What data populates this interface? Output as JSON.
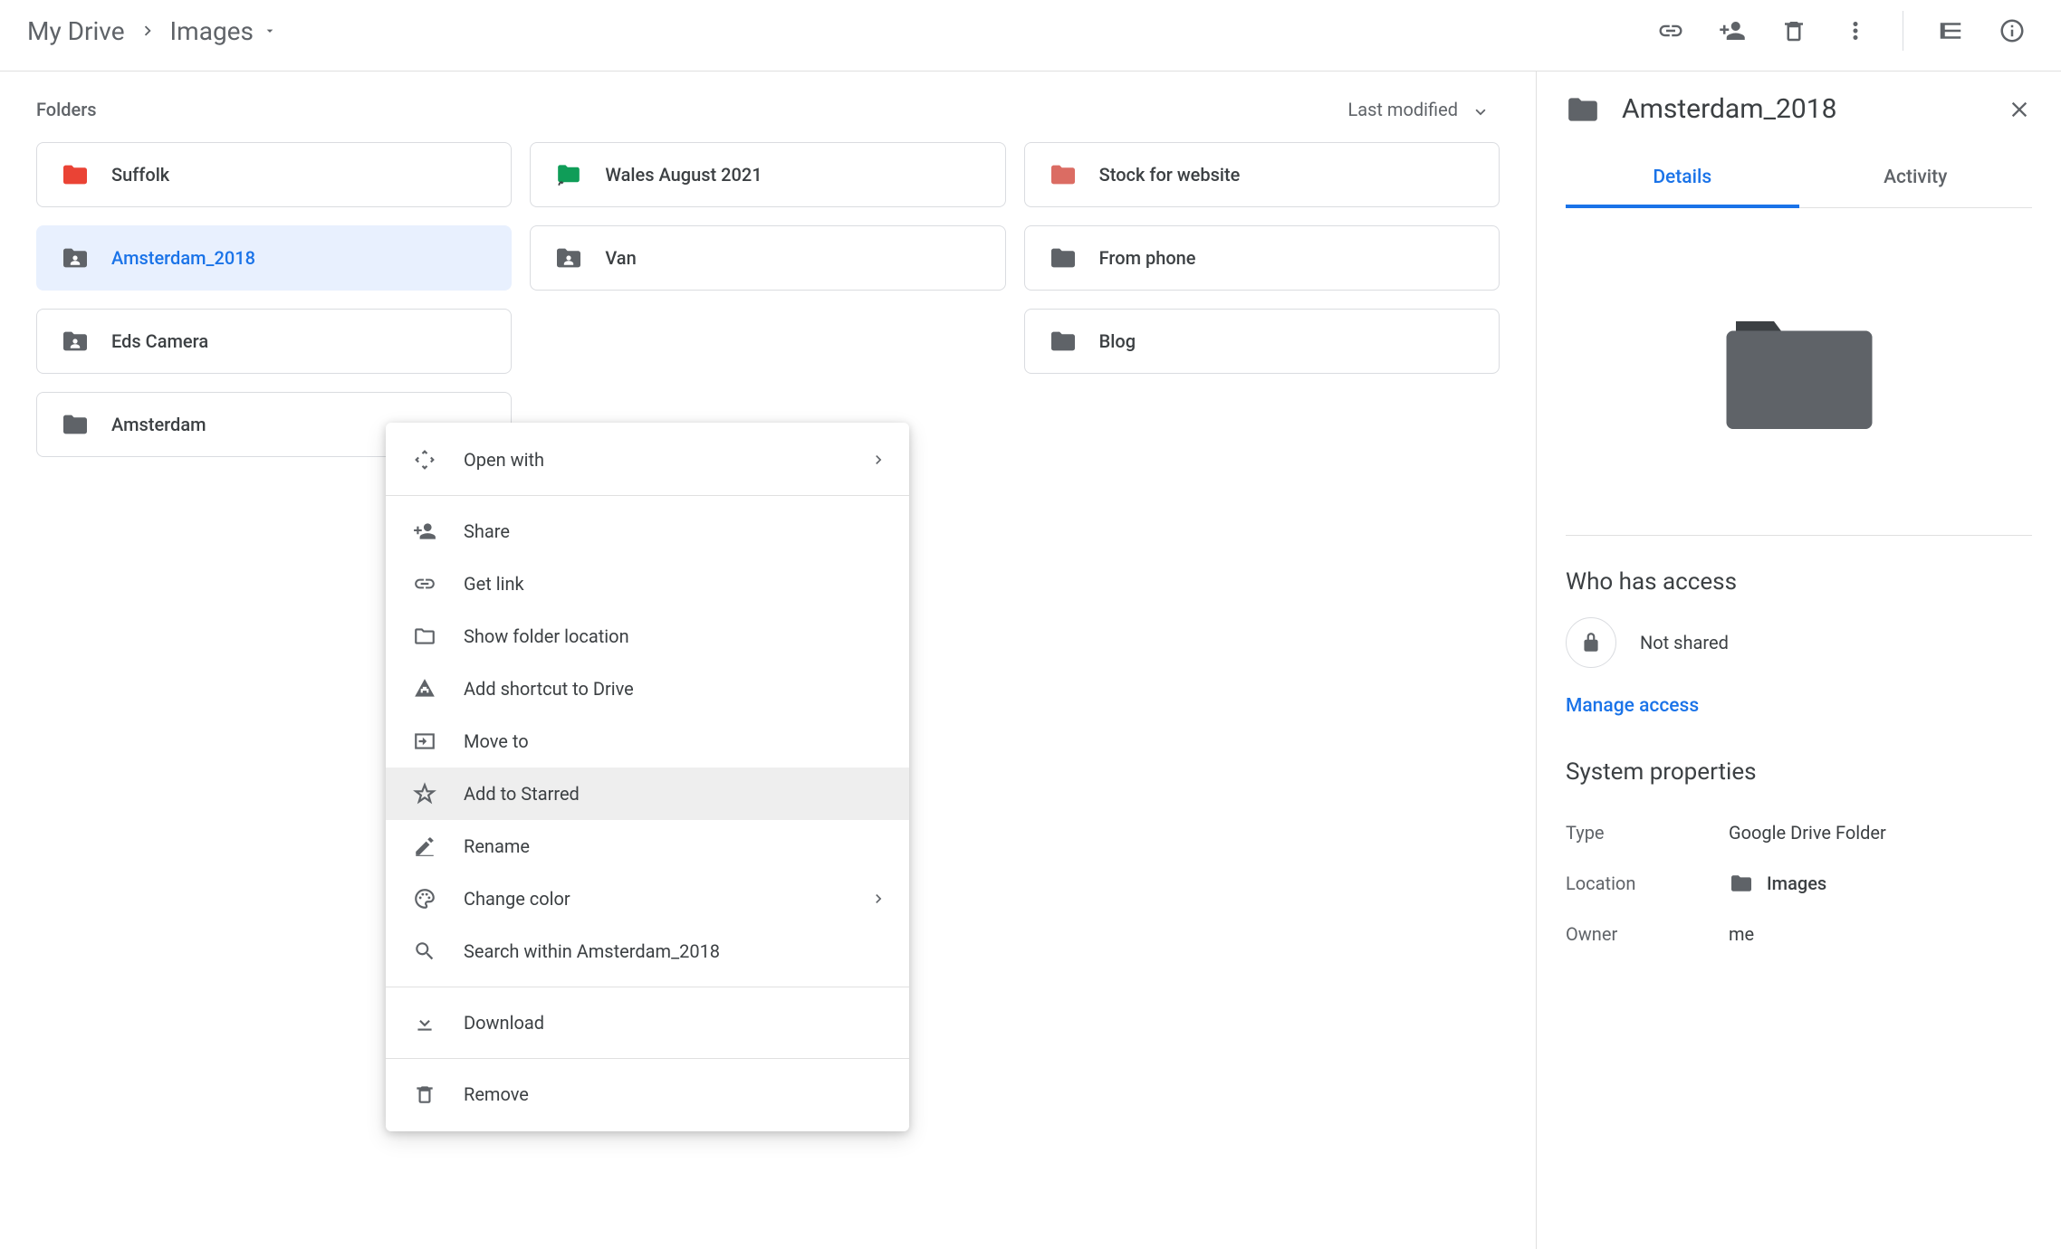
{
  "breadcrumbs": {
    "root": "My Drive",
    "current": "Images"
  },
  "section": {
    "title": "Folders",
    "sort": "Last modified"
  },
  "folders": [
    {
      "name": "Suffolk",
      "color": "#ea4335",
      "type": "plain"
    },
    {
      "name": "Wales August 2021",
      "color": "#0f9d58",
      "type": "shortcut"
    },
    {
      "name": "Stock for website",
      "color": "#db6c63",
      "type": "plain"
    },
    {
      "name": "Amsterdam_2018",
      "color": "#5f6368",
      "type": "shared",
      "selected": true
    },
    {
      "name": "Van",
      "color": "#5f6368",
      "type": "shared"
    },
    {
      "name": "From phone",
      "color": "#5f6368",
      "type": "plain"
    },
    {
      "name": "Eds Camera",
      "color": "#5f6368",
      "type": "shared"
    },
    {
      "name": "",
      "color": "",
      "type": "hidden"
    },
    {
      "name": "Blog",
      "color": "#5f6368",
      "type": "plain"
    },
    {
      "name": "Amsterdam",
      "color": "#5f6368",
      "type": "plain"
    }
  ],
  "contextMenu": {
    "openWith": "Open with",
    "share": "Share",
    "getLink": "Get link",
    "showLocation": "Show folder location",
    "addShortcut": "Add shortcut to Drive",
    "moveTo": "Move to",
    "addStarred": "Add to Starred",
    "rename": "Rename",
    "changeColor": "Change color",
    "searchWithin": "Search within Amsterdam_2018",
    "download": "Download",
    "remove": "Remove"
  },
  "details": {
    "title": "Amsterdam_2018",
    "tabs": {
      "details": "Details",
      "activity": "Activity"
    },
    "access": {
      "heading": "Who has access",
      "status": "Not shared",
      "manage": "Manage access"
    },
    "props": {
      "heading": "System properties",
      "type": {
        "label": "Type",
        "value": "Google Drive Folder"
      },
      "location": {
        "label": "Location",
        "value": "Images"
      },
      "owner": {
        "label": "Owner",
        "value": "me"
      }
    }
  }
}
